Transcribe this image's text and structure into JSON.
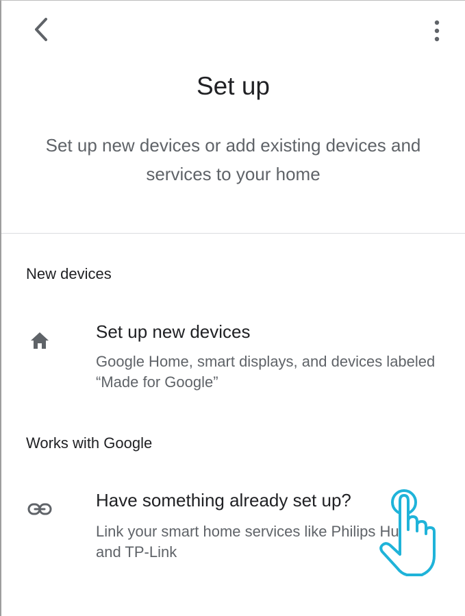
{
  "header": {
    "back_icon": "chevron-left-icon",
    "more_icon": "more-vert-icon"
  },
  "page": {
    "title": "Set up",
    "subtitle": "Set up new devices or add existing devices and services to your home"
  },
  "sections": {
    "new_devices": {
      "heading": "New devices",
      "item": {
        "icon": "home-icon",
        "title": "Set up new devices",
        "description": "Google Home, smart displays, and devices labeled “Made for Google”"
      }
    },
    "works_with_google": {
      "heading": "Works with Google",
      "item": {
        "icon": "link-icon",
        "title": "Have something already set up?",
        "description": "Link your smart home services like Philips Hue and TP-Link"
      }
    }
  },
  "colors": {
    "text_primary": "#202124",
    "text_secondary": "#5f6368",
    "icon": "#5f6368",
    "divider": "#dadce0",
    "cursor_accent": "#1fb3d9"
  },
  "overlay": {
    "cursor_icon": "pointing-hand-cursor-icon"
  }
}
